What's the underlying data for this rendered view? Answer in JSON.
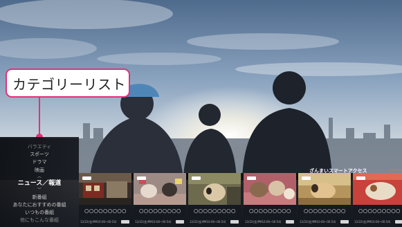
{
  "callout": {
    "label": "カテゴリーリスト"
  },
  "categories": {
    "items": [
      {
        "label": "バラエティ"
      },
      {
        "label": "スポーツ"
      },
      {
        "label": "ドラマ"
      },
      {
        "label": "映画"
      }
    ],
    "selected": {
      "label": "ニュース／報道"
    },
    "lower_items": [
      {
        "label": "新番組"
      },
      {
        "label": "あなたにおすすめの番組"
      },
      {
        "label": "いつもの番組"
      },
      {
        "label": "他にもこんな番組"
      }
    ],
    "up_arrow": "︿",
    "down_arrow": "﹀"
  },
  "program_row": {
    "title": "ざんまいスマートアクセス",
    "tiles": [
      {
        "title": "○○○○○○○○○",
        "time": "12/22(金)PM10:00~00:54)",
        "thumb": "train-station"
      },
      {
        "title": "○○○○○○○○○",
        "time": "12/22(金)PM10:00~00:54)",
        "thumb": "dogs-toys"
      },
      {
        "title": "○○○○○○○○○",
        "time": "12/22(金)PM10:00~00:54)",
        "thumb": "dog-car"
      },
      {
        "title": "○○○○○○○○○",
        "time": "12/22(金)PM10:00~00:54)",
        "thumb": "puppies"
      },
      {
        "title": "○○○○○○○○○",
        "time": "12/22(金)PM10:00~00:54)",
        "thumb": "dog-room"
      },
      {
        "title": "○○○○○○○○○",
        "time": "12/22(金)PM10:00~00:54)",
        "thumb": "dog-red"
      }
    ]
  },
  "colors": {
    "accent": "#e0317a",
    "panel": "#0a0c12"
  }
}
